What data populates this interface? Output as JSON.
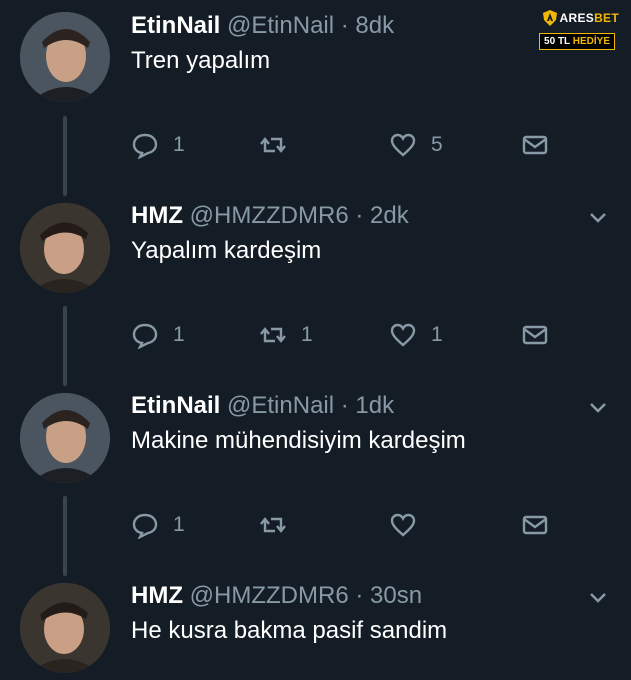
{
  "brand": {
    "name_prefix": "ARES",
    "name_suffix": "BET",
    "badge_amount": "50 TL",
    "badge_text": "HEDİYE"
  },
  "colors": {
    "background": "#141d26",
    "secondary_text": "#8899a6",
    "thread_line": "#38444d",
    "brand_accent": "#f2b705"
  },
  "tweets": [
    {
      "name": "EtinNail",
      "handle": "@EtinNail",
      "time": "· 8dk",
      "text": "Tren yapalım",
      "replies": "1",
      "retweets": "",
      "likes": "5",
      "has_chevron": false
    },
    {
      "name": "HMZ",
      "handle": "@HMZZDMR6",
      "time": "· 2dk",
      "text": "Yapalım kardeşim",
      "replies": "1",
      "retweets": "1",
      "likes": "1",
      "has_chevron": true
    },
    {
      "name": "EtinNail",
      "handle": "@EtinNail",
      "time": "· 1dk",
      "text": "Makine mühendisiyim kardeşim",
      "replies": "1",
      "retweets": "",
      "likes": "",
      "has_chevron": true
    },
    {
      "name": "HMZ",
      "handle": "@HMZZDMR6",
      "time": "· 30sn",
      "text": "He kusra bakma pasif sandim",
      "has_chevron": true
    }
  ],
  "icons": {
    "reply": "reply-icon",
    "retweet": "retweet-icon",
    "like": "like-icon",
    "dm": "direct-message-icon",
    "more": "chevron-down-icon"
  }
}
